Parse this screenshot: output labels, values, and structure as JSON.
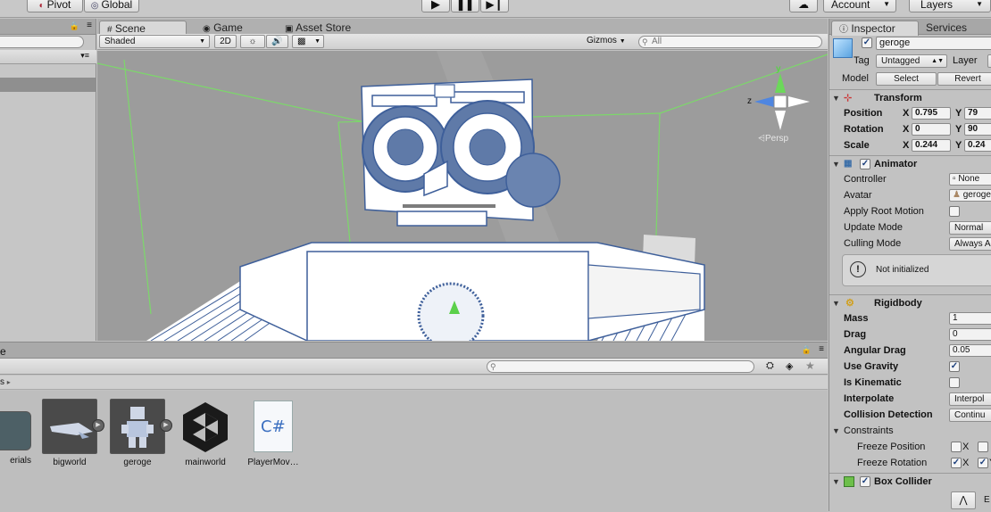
{
  "toolbar": {
    "pivot_label": "Pivot",
    "global_label": "Global",
    "account_label": "Account",
    "layers_label": "Layers"
  },
  "scene_tabs": [
    "Scene",
    "Game",
    "Asset Store"
  ],
  "scene_toolbar": {
    "shading_mode": "Shaded",
    "mode_2d": "2D",
    "gizmos_label": "Gizmos",
    "search_placeholder": "All",
    "persp_label": "Persp",
    "axis_y": "y",
    "axis_z": "z"
  },
  "project": {
    "breadcrumb_fragment": "s",
    "panel_title_fragment": "e",
    "assets": [
      {
        "label": "erials",
        "icon": "folder-icon"
      },
      {
        "label": "bigworld",
        "icon": "model-prefab-icon"
      },
      {
        "label": "geroge",
        "icon": "model-prefab-icon"
      },
      {
        "label": "mainworld",
        "icon": "unity-scene-icon"
      },
      {
        "label": "PlayerMov…",
        "icon": "csharp-script-icon"
      }
    ],
    "csharp_glyph": "C#"
  },
  "inspector": {
    "tabs": [
      "Inspector",
      "Services"
    ],
    "object_name": "geroge",
    "tag_label": "Tag",
    "tag_value": "Untagged",
    "layer_label": "Layer",
    "model_label": "Model",
    "select_label": "Select",
    "revert_label": "Revert",
    "transform": {
      "title": "Transform",
      "position_label": "Position",
      "rotation_label": "Rotation",
      "scale_label": "Scale",
      "x_label": "X",
      "y_label": "Y",
      "position_x": "0.795",
      "position_y": "79",
      "rotation_x": "0",
      "rotation_y": "90",
      "scale_x": "0.244",
      "scale_y": "0.24"
    },
    "animator": {
      "title": "Animator",
      "controller_label": "Controller",
      "controller_value": "None",
      "avatar_label": "Avatar",
      "avatar_value": "geroge",
      "apply_root_motion_label": "Apply Root Motion",
      "update_mode_label": "Update Mode",
      "update_mode_value": "Normal",
      "culling_mode_label": "Culling Mode",
      "culling_mode_value": "Always A",
      "warning_text": "Not initialized"
    },
    "rigidbody": {
      "title": "Rigidbody",
      "mass_label": "Mass",
      "mass_value": "1",
      "drag_label": "Drag",
      "drag_value": "0",
      "angular_drag_label": "Angular Drag",
      "angular_drag_value": "0.05",
      "use_gravity_label": "Use Gravity",
      "is_kinematic_label": "Is Kinematic",
      "interpolate_label": "Interpolate",
      "interpolate_value": "Interpol",
      "collision_label": "Collision Detection",
      "collision_value": "Continu",
      "constraints_label": "Constraints",
      "freeze_position_label": "Freeze Position",
      "freeze_rotation_label": "Freeze Rotation",
      "x_label": "X",
      "y_label": "Y"
    },
    "box_collider": {
      "title": "Box Collider",
      "edit_label": "E"
    }
  },
  "colors": {
    "selection_blue": "#3a6ea8",
    "wire_blue": "#3e5f9a",
    "bounds_green": "#7cd86a",
    "scene_bg": "#9c9c9c"
  }
}
